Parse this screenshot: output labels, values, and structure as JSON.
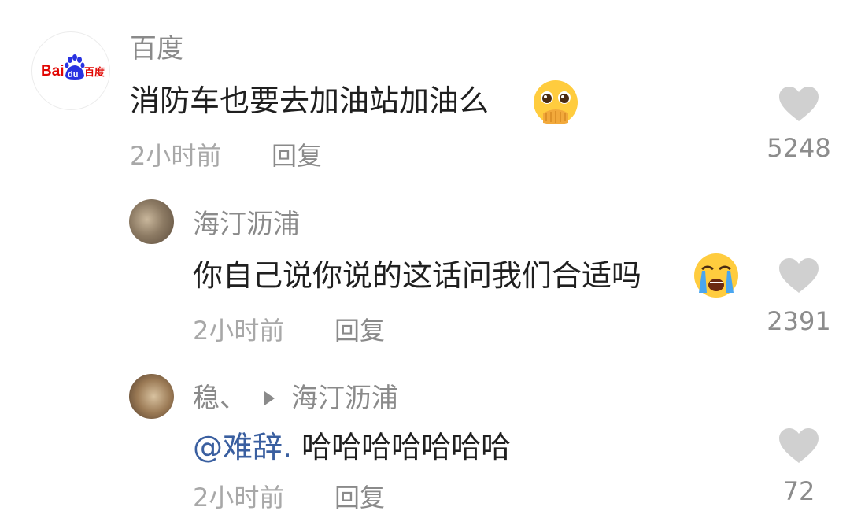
{
  "colors": {
    "text": "#1f1f1f",
    "username": "#8a8a8a",
    "meta": "#a8a8a8",
    "heart": "#d0d0d0",
    "mention": "#3a5fa0",
    "baidu_blue": "#2932e1",
    "baidu_red": "#e10602"
  },
  "logo": {
    "left": "Bai",
    "middle": "du",
    "right": "百度"
  },
  "comments": [
    {
      "user": "百度",
      "text": "消防车也要去加油站加油么",
      "emoji": "pleading-face-emoji",
      "time": "2小时前",
      "reply": "回复",
      "likes": "5248"
    },
    {
      "user": "海汀沥浦",
      "text": "你自己说你说的这话问我们合适吗",
      "emoji": "crying-face-emoji",
      "time": "2小时前",
      "reply": "回复",
      "likes": "2391"
    },
    {
      "user": "稳、",
      "reply_to": "海汀沥浦",
      "mention": "@难辞.",
      "text": " 哈哈哈哈哈哈哈",
      "time": "2小时前",
      "reply": "回复",
      "likes": "72"
    }
  ]
}
